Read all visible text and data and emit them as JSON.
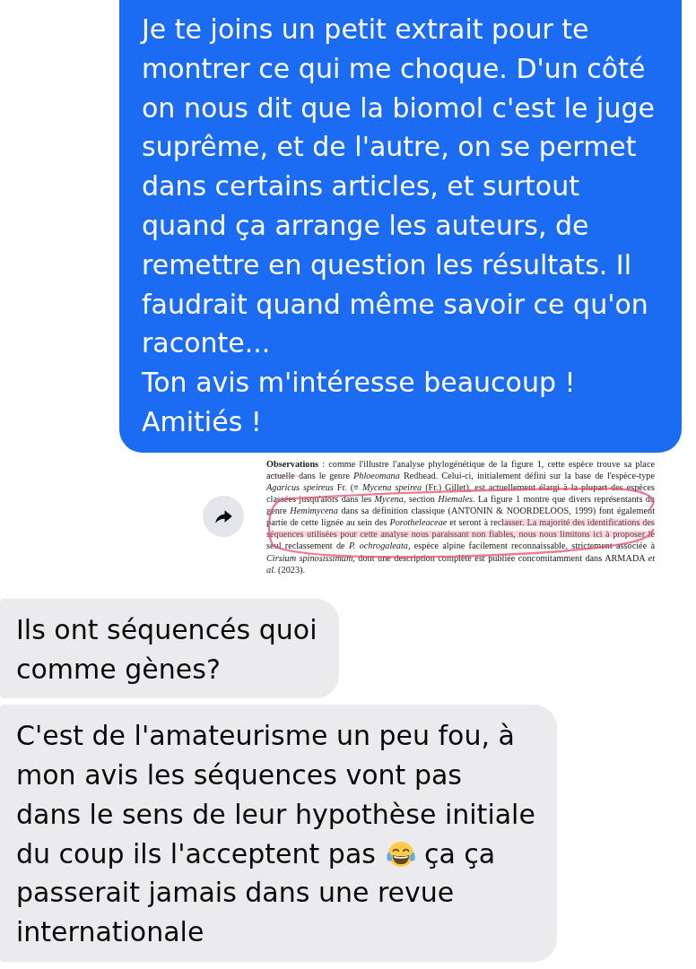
{
  "sent_message": {
    "text": "Je te joins un petit extrait pour te\nmontrer ce qui me choque. D'un côté\non nous dit que la biomol c'est le juge\nsuprême, et de l'autre, on se permet\ndans certains articles, et surtout\nquand ça arrange les auteurs, de\nremettre en question les résultats. Il\nfaudrait quand même savoir ce qu'on\nraconte...\nTon avis m'intéresse beaucoup !\nAmitiés !"
  },
  "shared_excerpt": {
    "text": "**Observations** : comme l'illustre l'analyse phylogénétique de la figure 1, cette espèce trouve sa place actuelle dans le genre *Phloeomana* Redhead. Celui-ci, initialement défini sur la base de l'espèce-type *Agaricus speireus* Fr. (≡ *Mycena speirea* (Fr.) Gillet), est actuellement élargi à la plupart des espèces classées jusqu'alors dans les *Mycena*, section *Hiemales*. La figure 1 montre que divers représentants du genre *Hemimycena* dans sa définition classique (ANTONIN & NOORDELOOS, 1999) font également partie de cette lignée au sein des *Porotheleaceae* et seront à reclasser. La majorité des identifications des séquences utilisées pour cette analyse nous paraissant non fiables, nous nous limitons ici à proposer le seul reclassement de *P. ochrogaleata*, espèce alpine facilement reconnaissable, strictement associée à *Cirsium spinosissimum*, dont une description complète est publiée concomitamment dans ARMADA *et al.* (2023)."
  },
  "received_messages": [
    {
      "text": "Ils ont séquencés quoi\ncomme gènes?"
    },
    {
      "text": "C'est de l'amateurisme un peu fou, à\nmon avis les séquences vont pas\ndans le sens de leur hypothèse initiale\ndu coup ils l'acceptent pas",
      "text_continued": "ça ça\npasserait jamais dans une revue\ninternationale"
    }
  ]
}
